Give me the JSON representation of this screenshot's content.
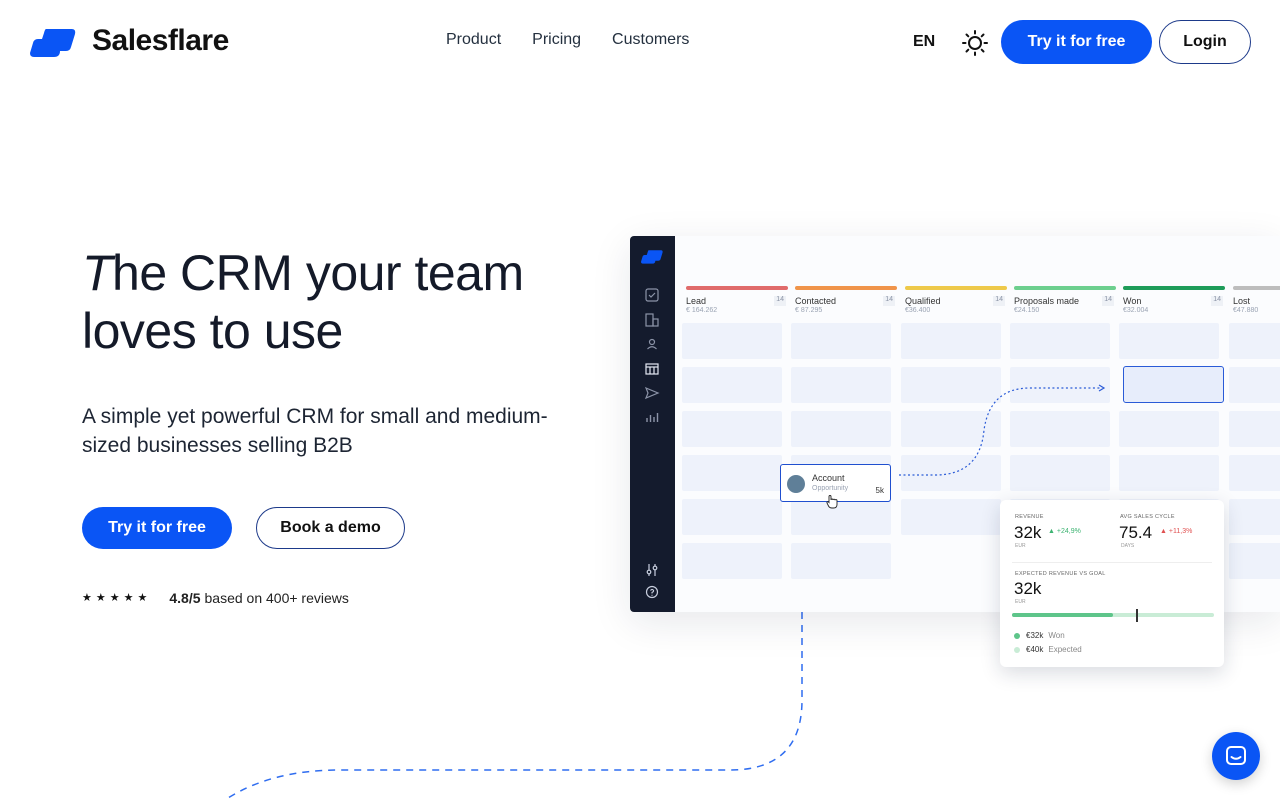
{
  "brand": {
    "name": "Salesflare",
    "color": "#0a55f5"
  },
  "nav": {
    "items": [
      "Product",
      "Pricing",
      "Customers"
    ]
  },
  "header": {
    "language": "EN",
    "try_label": "Try it for free",
    "login_label": "Login"
  },
  "hero": {
    "title_first_letter": "T",
    "title_rest": "he CRM your team loves to use",
    "subtitle": "A simple yet powerful CRM for small and medium-sized businesses selling B2B",
    "try_label": "Try it for free",
    "demo_label": "Book a demo",
    "rating_score": "4.8/5",
    "rating_text": "based on 400+ reviews",
    "stars": 5
  },
  "pipeline": {
    "columns": [
      {
        "name": "Lead",
        "count": "14",
        "amount": "€ 164.262",
        "color": "#e06b6b"
      },
      {
        "name": "Contacted",
        "count": "14",
        "amount": "€ 87.295",
        "color": "#f0944a"
      },
      {
        "name": "Qualified",
        "count": "14",
        "amount": "€36.400",
        "color": "#eec94a"
      },
      {
        "name": "Proposals made",
        "count": "14",
        "amount": "€24.150",
        "color": "#6ccf8e"
      },
      {
        "name": "Won",
        "count": "14",
        "amount": "€32.004",
        "color": "#1e9c59"
      },
      {
        "name": "Lost",
        "count": "14",
        "amount": "€47.880",
        "color": "#bdbdbd"
      }
    ],
    "card": {
      "name": "Account",
      "sub": "Opportunity",
      "value": "5k"
    }
  },
  "stats": {
    "revenue_label": "REVENUE",
    "revenue_value": "32k",
    "revenue_unit": "EUR",
    "revenue_delta": "+24,9%",
    "cycle_label": "AVG SALES CYCLE",
    "cycle_value": "75.4",
    "cycle_unit": "DAYS",
    "cycle_delta": "+11,3%",
    "expected_label": "EXPECTED REVENUE VS GOAL",
    "expected_value": "32k",
    "expected_unit": "EUR",
    "progress_fraction": 0.5,
    "won_value": "€32k",
    "won_label": "Won",
    "expected_legend_value": "€40k",
    "expected_legend_label": "Expected",
    "up_color": "#3cb371",
    "down_color": "#e05050"
  }
}
